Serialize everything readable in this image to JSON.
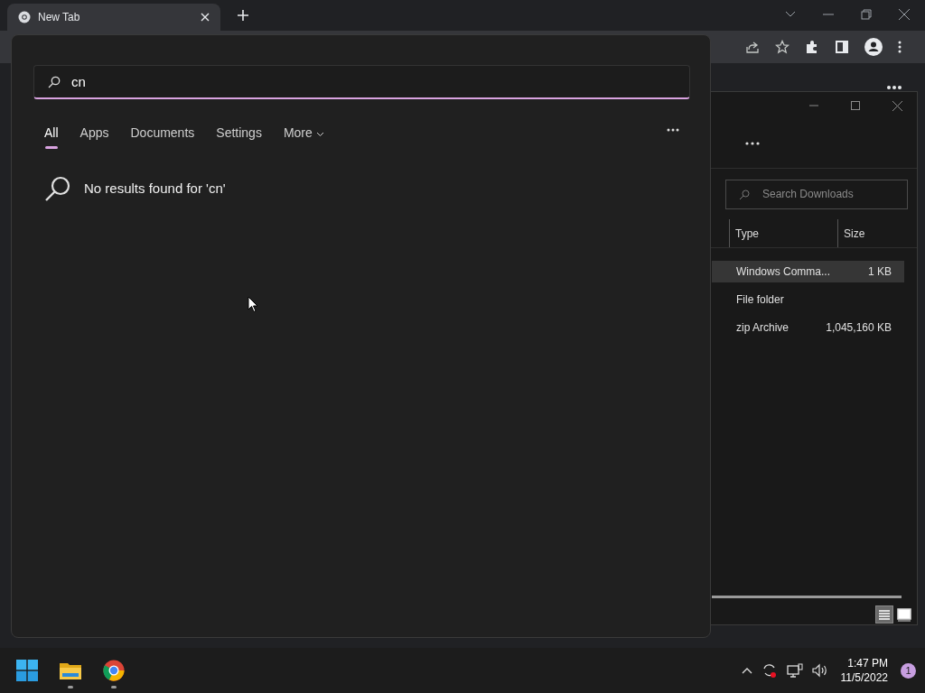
{
  "browser": {
    "tab": {
      "title": "New Tab"
    }
  },
  "explorer": {
    "search": {
      "placeholder": "Search Downloads"
    },
    "columns": [
      "Type",
      "Size"
    ],
    "rows": [
      {
        "type": "Windows Comma...",
        "size": "1 KB",
        "selected": true
      },
      {
        "type": "File folder",
        "selected": false
      },
      {
        "type": "zip Archive",
        "size": "1,045,160 KB",
        "selected": false
      }
    ],
    "view_buttons": [
      {
        "kind": "details",
        "selected": true
      },
      {
        "kind": "tiles",
        "selected": false
      }
    ]
  },
  "search_panel": {
    "query": "cn",
    "tabs": [
      {
        "label": "All",
        "selected": true
      },
      {
        "label": "Apps",
        "selected": false
      },
      {
        "label": "Documents",
        "selected": false
      },
      {
        "label": "Settings",
        "selected": false
      },
      {
        "label": "More",
        "selected": false,
        "dropdown": true
      }
    ],
    "message": "No results found for 'cn'"
  },
  "taskbar": {
    "apps": [
      {
        "kind": "start",
        "running": false
      },
      {
        "kind": "folder",
        "running": true
      },
      {
        "kind": "chrome",
        "running": true
      }
    ],
    "time": "1:47 PM",
    "date": "11/5/2022",
    "notification_count": "1"
  }
}
